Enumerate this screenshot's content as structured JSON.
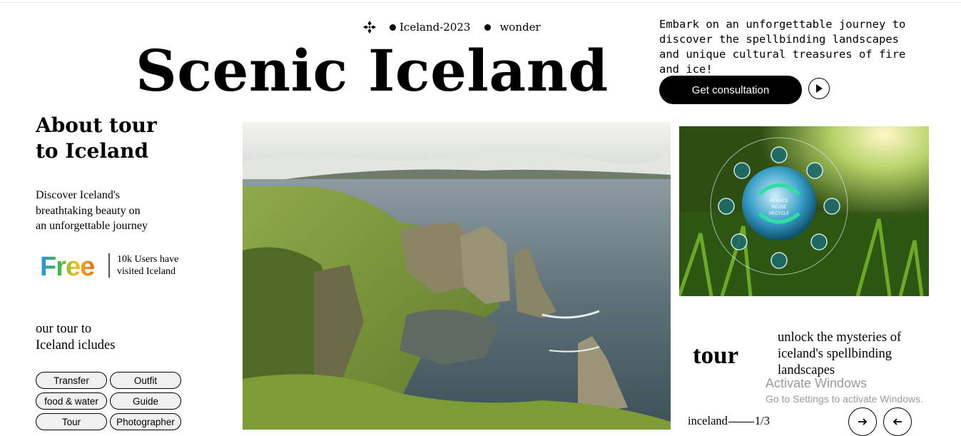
{
  "header": {
    "tags": [
      "Iceland-2023",
      "wonder"
    ],
    "title": "Scenic Iceland",
    "intro": "Embark on an unforgettable journey to discover the spellbinding landscapes and unique cultural treasures of fire and ice!",
    "cta_label": "Get consultation"
  },
  "about": {
    "heading_line1": "About tour",
    "heading_line2": "to Iceland",
    "desc_line1": "Discover Iceland's",
    "desc_line2": "breathtaking beauty on",
    "desc_line3": "an unforgettable journey",
    "free_logo": "Free",
    "users_line1": "10k Users have",
    "users_line2": "visited Iceland"
  },
  "includes": {
    "line1": "our tour to",
    "line2": "Iceland icludes",
    "items": [
      "Transfer",
      "Outfit",
      "food & water",
      "Guide",
      "Tour",
      "Photographer"
    ]
  },
  "eco_image": {
    "labels": [
      "REDUCE",
      "REUSE",
      "RECYCLE"
    ]
  },
  "tour_block": {
    "word": "tour",
    "text": "unlock the mysteries of iceland's spellbinding landscapes",
    "pager_label": "inceland",
    "pager_page": "1/3"
  },
  "watermark": {
    "line1": "Activate Windows",
    "line2": "Go to Settings to activate Windows."
  },
  "colors": {
    "accent": "#000000",
    "pill_bg": "#f0f0f0"
  },
  "icons": [
    "flower-logo-icon",
    "play-icon",
    "arrow-right-icon",
    "arrow-left-icon"
  ]
}
